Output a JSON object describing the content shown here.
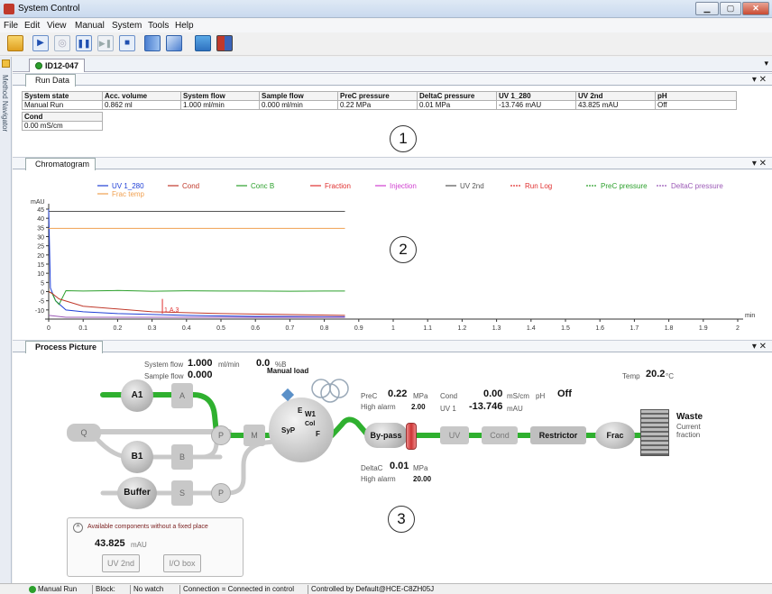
{
  "window": {
    "title": "System Control"
  },
  "menu": [
    "File",
    "Edit",
    "View",
    "Manual",
    "System",
    "Tools",
    "Help"
  ],
  "toolbar_icons": [
    "open-folder-icon",
    "run-icon",
    "pause-disabled-icon",
    "pause-icon",
    "step-icon",
    "stop-icon",
    "method-editor-icon",
    "evaluation-icon",
    "log-list-icon",
    "instrument-icon",
    "customize-icon"
  ],
  "document_tab": {
    "label": "ID12-047"
  },
  "left_nav": {
    "label": "Method Navigator"
  },
  "run_data": {
    "pane_title": "Run Data",
    "headers": [
      "System state",
      "Acc. volume",
      "System flow",
      "Sample flow",
      "PreC pressure",
      "DeltaC pressure",
      "UV 1_280",
      "UV 2nd",
      "pH"
    ],
    "values": [
      "Manual Run",
      "0.862 ml",
      "1.000 ml/min",
      "0.000 ml/min",
      "0.22 MPa",
      "0.01 MPa",
      "-13.746 mAU",
      "43.825 mAU",
      "Off"
    ],
    "cond_header": "Cond",
    "cond_value": "0.00 mS/cm",
    "callout": "1"
  },
  "chromatogram": {
    "pane_title": "Chromatogram",
    "callout": "2",
    "legend": [
      {
        "name": "UV 1_280",
        "color": "#1f3fd6"
      },
      {
        "name": "Cond",
        "color": "#c0392b"
      },
      {
        "name": "Conc B",
        "color": "#2ca02c"
      },
      {
        "name": "Fraction",
        "color": "#e03030"
      },
      {
        "name": "Injection",
        "color": "#d040d0"
      },
      {
        "name": "UV 2nd",
        "color": "#555555"
      },
      {
        "name": "Run Log",
        "color": "#e03030"
      },
      {
        "name": "PreC pressure",
        "color": "#2ca02c"
      },
      {
        "name": "DeltaC pressure",
        "color": "#9b59b6"
      },
      {
        "name": "Frac temp",
        "color": "#f0a050"
      }
    ],
    "marker_label": "1.A.3"
  },
  "chart_data": {
    "type": "line",
    "xlabel": "min",
    "ylabel": "mAU",
    "xlim": [
      0,
      2
    ],
    "ylim": [
      -15,
      45
    ],
    "xticks": [
      "0",
      "0.1",
      "0.2",
      "0.3",
      "0.4",
      "0.5",
      "0.6",
      "0.7",
      "0.8",
      "0.9",
      "1",
      "1.1",
      "1.2",
      "1.3",
      "1.4",
      "1.5",
      "1.6",
      "1.7",
      "1.8",
      "1.9",
      "2"
    ],
    "yticks": [
      "45",
      "40",
      "35",
      "30",
      "25",
      "20",
      "15",
      "10",
      "5",
      "0",
      "-5",
      "-10"
    ],
    "series": [
      {
        "name": "UV 1_280",
        "color": "#1f3fd6",
        "x": [
          0,
          0.005,
          0.02,
          0.05,
          0.1,
          0.2,
          0.3,
          0.4,
          0.5,
          0.6,
          0.7,
          0.8,
          0.86
        ],
        "y": [
          45,
          2,
          -5,
          -10,
          -11,
          -12,
          -12.5,
          -13,
          -13.3,
          -13.5,
          -13.6,
          -13.7,
          -13.7
        ]
      },
      {
        "name": "Conc B",
        "color": "#2ca02c",
        "x": [
          0,
          0.01,
          0.02,
          0.03,
          0.05,
          0.1,
          0.2,
          0.3,
          0.4,
          0.5,
          0.6,
          0.7,
          0.8,
          0.86
        ],
        "y": [
          0,
          -1,
          -5,
          -7,
          0.5,
          0.3,
          0.6,
          0.2,
          0.4,
          0.3,
          0.3,
          0.2,
          0.3,
          0.3
        ]
      },
      {
        "name": "UV 2nd",
        "color": "#555555",
        "x": [
          0,
          0.86
        ],
        "y": [
          43.8,
          43.8
        ]
      },
      {
        "name": "Frac temp",
        "color": "#f0a050",
        "x": [
          0,
          0.86
        ],
        "y": [
          34.5,
          34.5
        ]
      },
      {
        "name": "Cond",
        "color": "#c0392b",
        "x": [
          0,
          0.01,
          0.03,
          0.1,
          0.3,
          0.5,
          0.86
        ],
        "y": [
          0,
          -1,
          -4,
          -8,
          -11,
          -12,
          -13
        ]
      },
      {
        "name": "DeltaC pressure",
        "color": "#9b59b6",
        "x": [
          0,
          0.05,
          0.2,
          0.5,
          0.86
        ],
        "y": [
          -13,
          -14,
          -14,
          -14,
          -14
        ]
      }
    ],
    "fraction_marker": {
      "x": 0.33,
      "label": "1.A.3"
    }
  },
  "process": {
    "pane_title": "Process Picture",
    "callout": "3",
    "system_flow_label": "System flow",
    "system_flow_value": "1.000",
    "system_flow_unit": "ml/min",
    "percent_b_value": "0.0",
    "percent_b_unit": "%B",
    "sample_flow_label": "Sample flow",
    "sample_flow_value": "0.000",
    "manual_load": "Manual load",
    "prec_label": "PreC",
    "prec_value": "0.22",
    "prec_unit": "MPa",
    "high_alarm_label": "High alarm",
    "prec_alarm": "2.00",
    "cond_label": "Cond",
    "cond_value": "0.00",
    "cond_unit": "mS/cm",
    "ph_label": "pH",
    "ph_value": "Off",
    "uv1_label": "UV 1",
    "uv1_value": "-13.746",
    "uv1_unit": "mAU",
    "deltac_label": "DeltaC",
    "deltac_value": "0.01",
    "deltac_unit": "MPa",
    "deltac_alarm": "20.00",
    "temp_label": "Temp",
    "temp_value": "20.2",
    "temp_unit": "°C",
    "waste_label": "Waste",
    "current_fraction": "Current fraction",
    "components": {
      "q": "Q",
      "a1": "A1",
      "a": "A",
      "b1": "B1",
      "b": "B",
      "buffer": "Buffer",
      "s": "S",
      "p1": "P",
      "p2": "P",
      "m": "M",
      "syp": "SyP",
      "e": "E",
      "w1": "W1",
      "col": "Col",
      "f": "F",
      "bypass": "By-pass",
      "uv": "UV",
      "cond": "Cond",
      "restrictor": "Restrictor",
      "frac": "Frac"
    },
    "available_label": "Available components without a fixed place",
    "available_value": "43.825",
    "available_unit": "mAU",
    "uv2nd_button": "UV 2nd",
    "io_button": "I/O box"
  },
  "status": {
    "run_state": "Manual Run",
    "block": "Block:",
    "watch": "No watch",
    "connection": "Connection = Connected in control",
    "controlled_by": "Controlled by Default@HCE-C8ZH05J"
  }
}
